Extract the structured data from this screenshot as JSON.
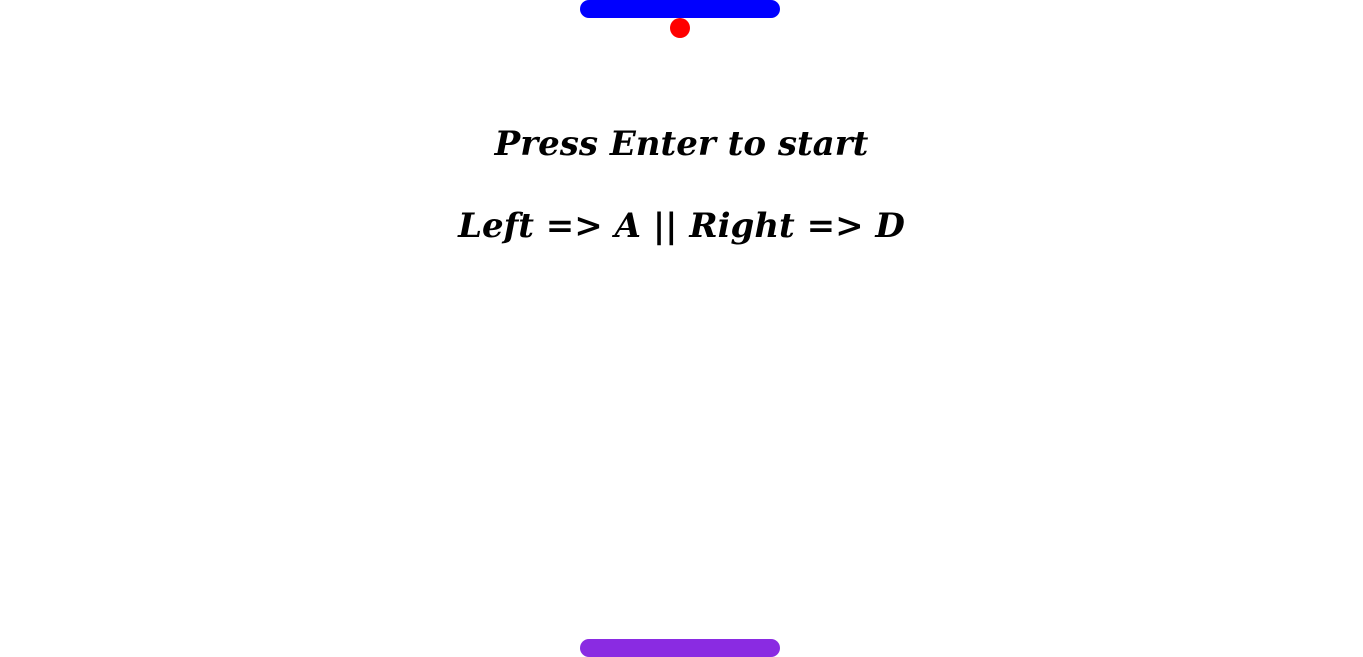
{
  "game": {
    "start_prompt": "Press Enter to start",
    "controls_hint": "Left => A || Right => D"
  },
  "colors": {
    "top_paddle": "#0000ff",
    "bottom_paddle": "#8a2be2",
    "ball": "#ff0000",
    "background": "#ffffff",
    "text": "#000000"
  }
}
